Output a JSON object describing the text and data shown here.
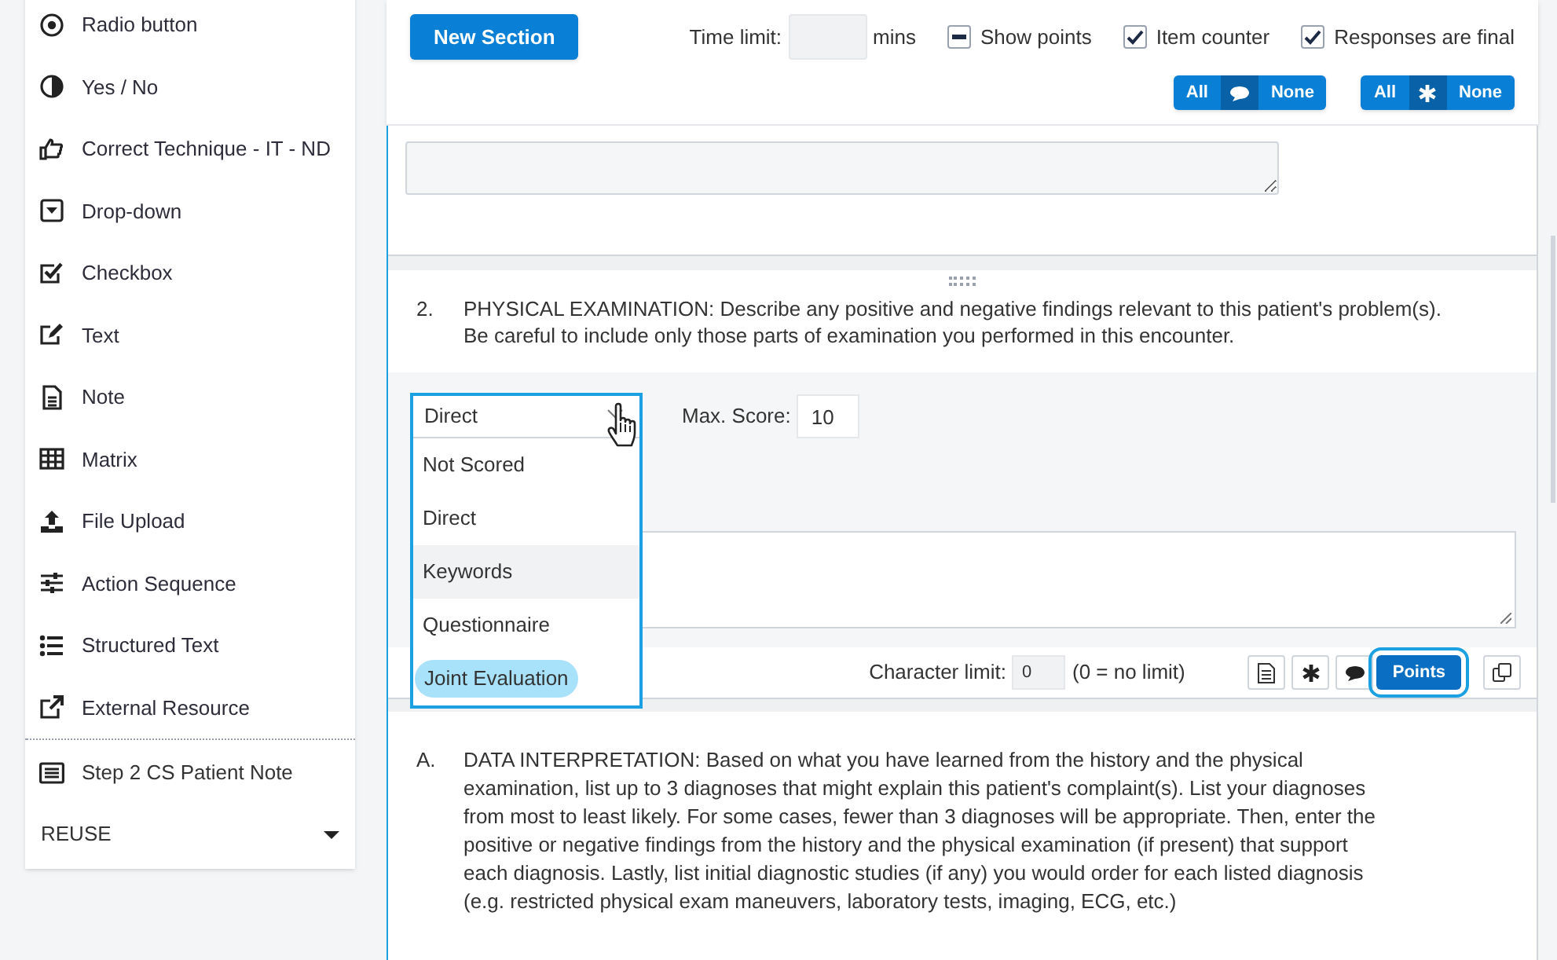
{
  "sidebar": {
    "items": [
      {
        "label": "Radio button"
      },
      {
        "label": "Yes / No"
      },
      {
        "label": "Correct Technique - IT - ND"
      },
      {
        "label": "Drop-down"
      },
      {
        "label": "Checkbox"
      },
      {
        "label": "Text"
      },
      {
        "label": "Note"
      },
      {
        "label": "Matrix"
      },
      {
        "label": "File Upload"
      },
      {
        "label": "Action Sequence"
      },
      {
        "label": "Structured Text"
      },
      {
        "label": "External Resource"
      }
    ],
    "templates": [
      {
        "label": "Step 2 CS Patient Note"
      }
    ],
    "reuse": {
      "label": "REUSE"
    }
  },
  "toolbar": {
    "new_section": "New Section",
    "time_limit": {
      "label": "Time limit:",
      "unit": "mins"
    },
    "options": [
      {
        "label": "Show points",
        "checked": true,
        "indeterminate": true
      },
      {
        "label": "Item counter",
        "checked": true,
        "indeterminate": false
      },
      {
        "label": "Responses are final",
        "checked": true,
        "indeterminate": false
      }
    ],
    "toggle_groups": [
      {
        "all": "All",
        "none": "None"
      },
      {
        "all": "All",
        "none": "None"
      }
    ]
  },
  "question": {
    "number": "2.",
    "text": "PHYSICAL EXAMINATION: Describe any positive and negative findings relevant to this patient's problem(s). Be careful to include only those parts of examination you performed in this encounter.",
    "scoring": {
      "value": "Direct",
      "expanded": true,
      "options": [
        {
          "label": "Not Scored",
          "hovered": false,
          "highlighted": false
        },
        {
          "label": "Direct",
          "hovered": false,
          "highlighted": false
        },
        {
          "label": "Keywords",
          "hovered": true,
          "highlighted": false
        },
        {
          "label": "Questionnaire",
          "hovered": false,
          "highlighted": false
        },
        {
          "label": "Joint Evaluation",
          "hovered": false,
          "highlighted": true
        }
      ]
    },
    "max_score": {
      "label": "Max. Score:",
      "value": "10"
    },
    "character_limit": {
      "label": "Character limit:",
      "value": "0",
      "hint": "(0 = no limit)"
    },
    "points_button": {
      "label": "Points",
      "focused": true
    }
  },
  "next_section": {
    "number": "A.",
    "text": "DATA INTERPRETATION: Based on what you have learned from the history and the physical examination, list up to 3 diagnoses that might explain this patient's complaint(s). List your diagnoses from most to least likely. For some cases, fewer than 3 diagnoses will be appropriate. Then, enter the positive or negative findings from the history and the physical examination (if present) that support each diagnosis. Lastly, list initial diagnostic studies (if any) you would order for each listed diagnosis (e.g. restricted physical exam maneuvers, laboratory tests, imaging, ECG, etc.)"
  }
}
